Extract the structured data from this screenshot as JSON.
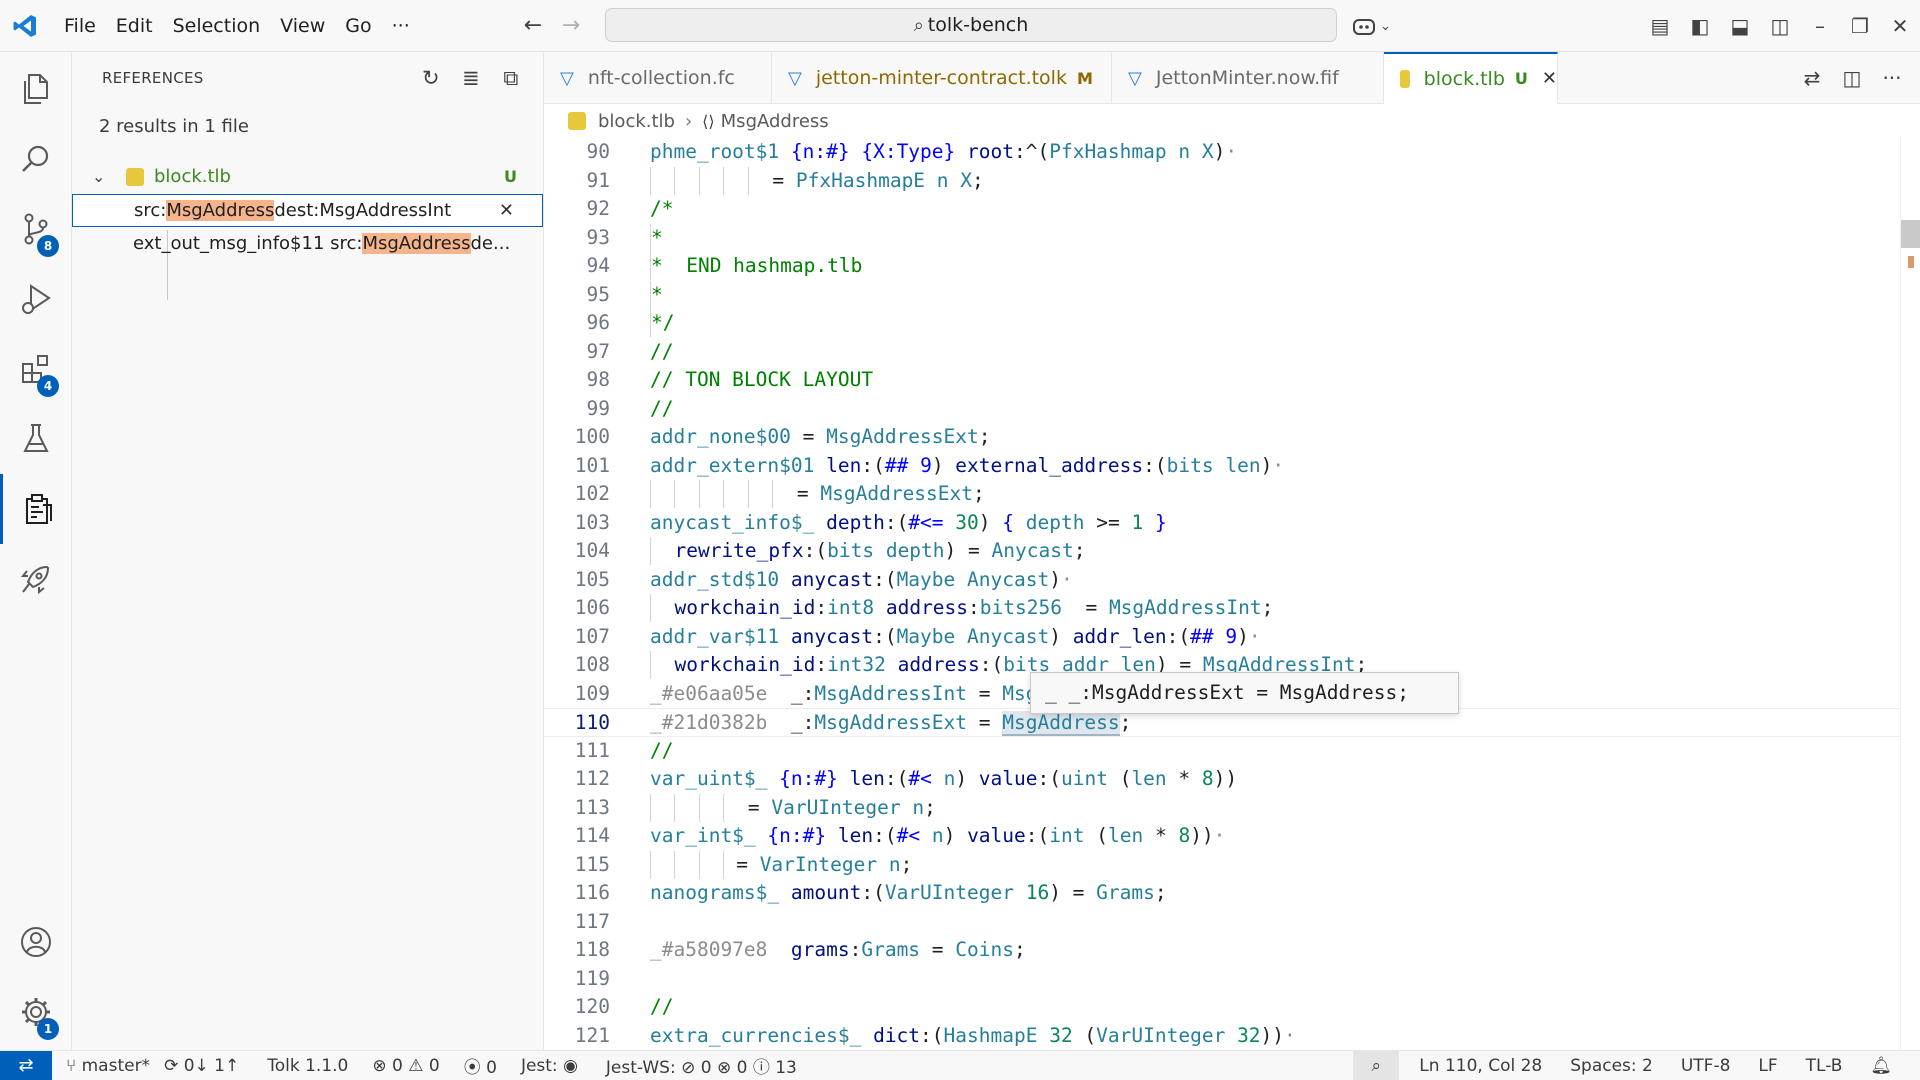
{
  "titlebar": {
    "menus": [
      "File",
      "Edit",
      "Selection",
      "View",
      "Go",
      "···"
    ],
    "command_center": "tolk-bench",
    "copilot_icon": "copilot-icon"
  },
  "activitybar": {
    "source_control_badge": "8",
    "extensions_badge": "4",
    "settings_badge": "1"
  },
  "sidebar": {
    "title": "REFERENCES",
    "summary": "2 results in 1 file",
    "file": {
      "name": "block.tlb",
      "status": "U"
    },
    "results": [
      {
        "pre": "src:",
        "match": "MsgAddress",
        "post": " dest:MsgAddressInt"
      },
      {
        "pre": "ext_out_msg_info$11 src:",
        "match": "MsgAddress",
        "post": " de..."
      }
    ]
  },
  "tabs": [
    {
      "label": "nft-collection.fc",
      "flag": ""
    },
    {
      "label": "jetton-minter-contract.tolk",
      "flag": "M"
    },
    {
      "label": "JettonMinter.now.fif",
      "flag": ""
    },
    {
      "label": "block.tlb",
      "flag": "U"
    }
  ],
  "breadcrumb": {
    "file": "block.tlb",
    "symbol": "MsgAddress"
  },
  "editor": {
    "line_numbers": [
      "90",
      "91",
      "92",
      "93",
      "94",
      "95",
      "96",
      "97",
      "98",
      "99",
      "100",
      "101",
      "102",
      "103",
      "104",
      "105",
      "106",
      "107",
      "108",
      "109",
      "110",
      "111",
      "112",
      "113",
      "114",
      "115",
      "116",
      "117",
      "118",
      "119",
      "120",
      "121"
    ],
    "current_line": "110",
    "hover_text": "_ _:MsgAddressExt = MsgAddress;"
  },
  "statusbar": {
    "branch": "master*",
    "sync": "0↓ 1↑",
    "language_version": "Tolk 1.1.0",
    "problems": "⊗ 0 ⚠ 0",
    "ports": "0",
    "jest": "Jest:",
    "jest_ws": "Jest-WS: ⊘ 0 ⊗ 0 ⓘ 13",
    "position": "Ln 110, Col 28",
    "spaces": "Spaces: 2",
    "encoding": "UTF-8",
    "eol": "LF",
    "language": "TL-B"
  }
}
